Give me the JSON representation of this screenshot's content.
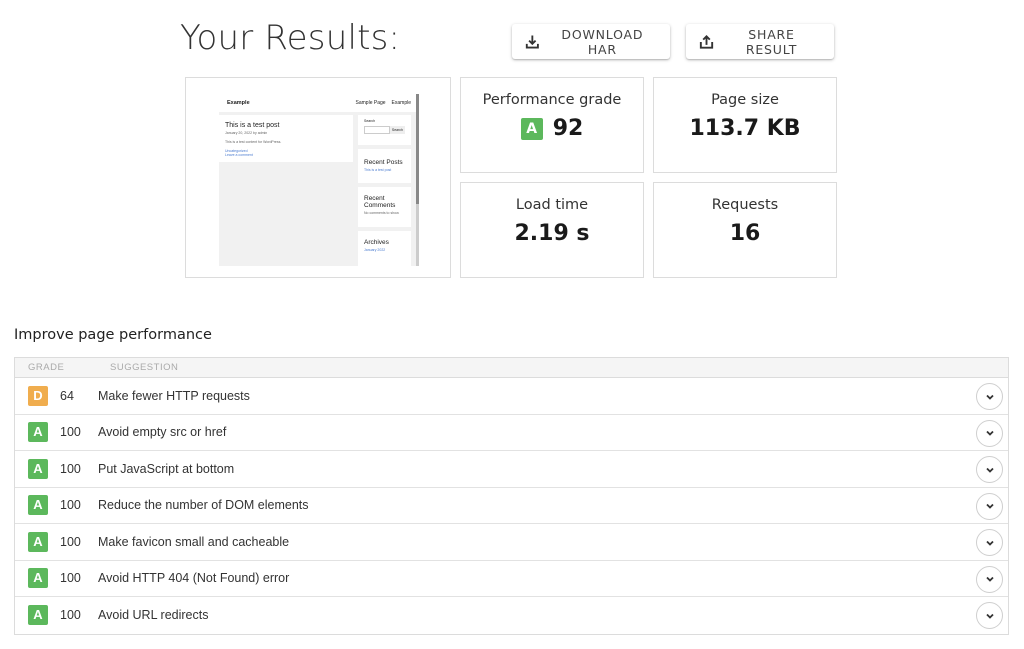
{
  "header": {
    "title": "Your Results:",
    "download_label": "DOWNLOAD HAR",
    "share_label": "SHARE RESULT"
  },
  "preview": {
    "site_title": "Example",
    "nav": [
      "Sample Page",
      "Example"
    ],
    "post_title": "This is a test post",
    "post_meta": "January 20, 2022 by admin",
    "post_text": "This is a test content for WordPress.",
    "post_links": [
      "Uncategorized",
      "Leave a comment"
    ],
    "search_label": "Search",
    "search_button": "Search",
    "recent_posts_title": "Recent Posts",
    "recent_posts_link": "This is a test post",
    "recent_comments_title": "Recent Comments",
    "recent_comments_text": "No comments to show.",
    "archives_title": "Archives",
    "archives_link": "January 2022"
  },
  "metrics": {
    "performance": {
      "label": "Performance grade",
      "grade": "A",
      "value": "92"
    },
    "page_size": {
      "label": "Page size",
      "value": "113.7 KB"
    },
    "load_time": {
      "label": "Load time",
      "value": "2.19 s"
    },
    "requests": {
      "label": "Requests",
      "value": "16"
    }
  },
  "improve": {
    "title": "Improve page performance",
    "columns": {
      "grade": "GRADE",
      "suggestion": "SUGGESTION"
    },
    "rows": [
      {
        "grade": "D",
        "score": "64",
        "suggestion": "Make fewer HTTP requests",
        "color": "#f0ad4e"
      },
      {
        "grade": "A",
        "score": "100",
        "suggestion": "Avoid empty src or href",
        "color": "#5cb85c"
      },
      {
        "grade": "A",
        "score": "100",
        "suggestion": "Put JavaScript at bottom",
        "color": "#5cb85c"
      },
      {
        "grade": "A",
        "score": "100",
        "suggestion": "Reduce the number of DOM elements",
        "color": "#5cb85c"
      },
      {
        "grade": "A",
        "score": "100",
        "suggestion": "Make favicon small and cacheable",
        "color": "#5cb85c"
      },
      {
        "grade": "A",
        "score": "100",
        "suggestion": "Avoid HTTP 404 (Not Found) error",
        "color": "#5cb85c"
      },
      {
        "grade": "A",
        "score": "100",
        "suggestion": "Avoid URL redirects",
        "color": "#5cb85c"
      }
    ]
  },
  "colors": {
    "grade_a": "#5cb85c",
    "grade_d": "#f0ad4e"
  },
  "icons": {
    "download": "download-icon",
    "share": "share-icon",
    "expand": "chevron-down-icon"
  }
}
